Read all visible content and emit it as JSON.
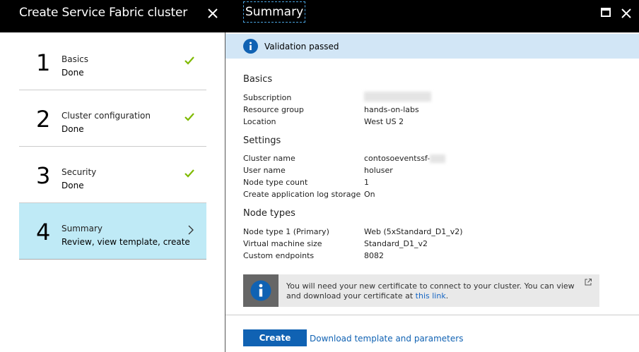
{
  "left_blade": {
    "title": "Create Service Fabric cluster",
    "steps": [
      {
        "number": "1",
        "name": "Basics",
        "status": "Done",
        "icon": "check-icon"
      },
      {
        "number": "2",
        "name": "Cluster configuration",
        "status": "Done",
        "icon": "check-icon"
      },
      {
        "number": "3",
        "name": "Security",
        "status": "Done",
        "icon": "check-icon"
      },
      {
        "number": "4",
        "name": "Summary",
        "status": "Review, view template, create",
        "icon": "chevron-right-icon"
      }
    ]
  },
  "summary_blade": {
    "title": "Summary",
    "validation": "Validation passed",
    "sections": {
      "basics": {
        "title": "Basics",
        "rows": [
          {
            "key": "Subscription",
            "value": ""
          },
          {
            "key": "Resource group",
            "value": "hands-on-labs"
          },
          {
            "key": "Location",
            "value": "West US 2"
          }
        ]
      },
      "settings": {
        "title": "Settings",
        "rows": [
          {
            "key": "Cluster name",
            "value": "contosoeventssf-"
          },
          {
            "key": "User name",
            "value": "holuser"
          },
          {
            "key": "Node type count",
            "value": "1"
          },
          {
            "key": "Create application log storage",
            "value": "On"
          }
        ]
      },
      "node_types": {
        "title": "Node types",
        "rows": [
          {
            "key": "Node type 1 (Primary)",
            "value": "Web (5xStandard_D1_v2)"
          },
          {
            "key": "Virtual machine size",
            "value": "Standard_D1_v2"
          },
          {
            "key": "Custom endpoints",
            "value": "8082"
          }
        ]
      }
    },
    "info": {
      "text": "You will need your new certificate to connect to your cluster. You can view and download your certificate at ",
      "link": "this link",
      "suffix": "."
    },
    "create_label": "Create",
    "download_label": "Download template and parameters"
  },
  "colors": {
    "accent": "#1062b3",
    "check": "#7fba00",
    "active_step": "#bfeaf6",
    "validation_bg": "#d2e6f6"
  }
}
